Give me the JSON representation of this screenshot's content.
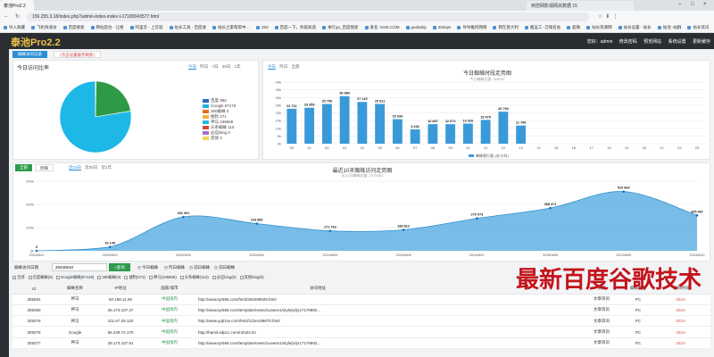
{
  "browser": {
    "tab_title": "泰池Pro2.2",
    "tab_right_title": "到您网影视网关数据 15",
    "url": "156.255.3.18/index.php?admin-index-index-t-17180043577.html",
    "bookmarks": [
      "导入收藏",
      "飞机快速访",
      "百度搜索",
      "网站后台 - 让搜",
      "阿里云 - 上云就",
      "站长工具 - 百度收",
      "站长之家帮帮中…",
      "263",
      "百度一下，你就知道",
      "本叮go_百度搜索",
      "爱名 -DNS.COM",
      "godaddy",
      "263vps",
      "导导推的网络",
      "我在意大利",
      "搬运工 -泛域名站",
      "超微",
      "站长资源网",
      "站长设置 - 站长",
      "站池 -站群",
      "站长资讯",
      "所有书签"
    ]
  },
  "nav": {
    "logo": "泰池Pro2.2",
    "greeting": "您好：admin",
    "links": [
      "修改密码",
      "预览网站",
      "系统设置",
      "更新缓存"
    ]
  },
  "content_tabs": {
    "active": "蜘蛛访问记录",
    "second": "(点击设置缓存刷新)"
  },
  "pie_panel": {
    "title": "今日访问比率",
    "range_tabs": [
      "今日",
      "昨日",
      "7日",
      "30日",
      "1年"
    ],
    "selected": "今日",
    "legend": [
      {
        "label": "百度 986",
        "color": "#2b6bb5"
      },
      {
        "label": "Google 67178",
        "color": "#21b0de"
      },
      {
        "label": "360蜘蛛 0",
        "color": "#e96b2a"
      },
      {
        "label": "搜狗 271",
        "color": "#f0b23a"
      },
      {
        "label": "神马 236506",
        "color": "#1eb8e6"
      },
      {
        "label": "头条蜘蛛 110",
        "color": "#ce4b3a"
      },
      {
        "label": "必应Bing 0",
        "color": "#a46bd2"
      },
      {
        "label": "其他 0",
        "color": "#f5d25a"
      }
    ]
  },
  "hourly_panel": {
    "range_tabs": [
      "今日",
      "昨日",
      "全部"
    ],
    "selected": "今日",
    "title": "今日蜘蛛时段走势图",
    "subtitle": "今日蜘蛛总量: 305087",
    "legend": "蜘蛛爬行量 (次/小时)"
  },
  "trend_panel": {
    "buttons": [
      "全部",
      "明细"
    ],
    "range_tabs": [
      "近10日",
      "近30日",
      "近1年"
    ],
    "selected": "近10日",
    "title": "最近10天蜘蛛访问走势图",
    "subtitle": "近10日蜘蛛总量: 2375551"
  },
  "search": {
    "label": "蜘蛛访问日期",
    "value": "20240610",
    "button": "查询",
    "links": [
      "今日蜘蛛",
      "昨日蜘蛛",
      "前日蜘蛛",
      "前日蜘蛛"
    ]
  },
  "filters": [
    "全部",
    "百度蜘蛛(6)",
    "Google蜘蛛(87148)",
    "360蜘蛛(0)",
    "搜狗(271)",
    "神马(236506)",
    "头条蜘蛛(110)",
    "必应bing(0)",
    "其他bing(0)"
  ],
  "table": {
    "columns": [
      "Id",
      "蜘蛛名称",
      "IP地址",
      "国家/城市",
      "访问地址",
      "",
      "来源",
      "蜘蛛类型",
      "访问时间"
    ],
    "rows": [
      [
        "305081",
        "神马",
        "60.188.11.90",
        "中国境内",
        "http://www.tyr568.com/html/30d499929.html",
        "",
        "文章资讯",
        "PC",
        "2024-"
      ],
      [
        "305080",
        "神马",
        "39.173.107.37",
        "中国境内",
        "http://www.tyr568.com/template/news/zuowen1/style/js/js17179992...",
        "",
        "文章资讯",
        "PC",
        "2024-"
      ],
      [
        "305079",
        "神马",
        "101.67.29.120",
        "中国境内",
        "http://www.yqbzss.com/html/122e199870.html",
        "",
        "文章资讯",
        "PC",
        "2024-"
      ],
      [
        "305078",
        "Google",
        "66.249.72.170",
        "中国境内",
        "http://hamil.edpcc.com/robots.txt",
        "",
        "文章资讯",
        "PC",
        "2024-"
      ],
      [
        "305077",
        "神马",
        "39.173.107.91",
        "中国境内",
        "http://www.tyr568.com/template/news/zuowen1/style/js/js17179992...",
        "",
        "文章资讯",
        "PC",
        "2024-"
      ]
    ]
  },
  "watermark": "最新百度谷歌技术",
  "chart_data": [
    {
      "type": "pie",
      "labels": [
        "百度",
        "Google",
        "360蜘蛛",
        "搜狗",
        "神马",
        "头条蜘蛛",
        "必应Bing",
        "其他"
      ],
      "values": [
        986,
        67178,
        0,
        271,
        236506,
        110,
        0,
        0
      ],
      "colors": [
        "#2b6bb5",
        "#2e9a46",
        "#e96b2a",
        "#f0b23a",
        "#1eb8e6",
        "#ce4b3a",
        "#a46bd2",
        "#f5d25a"
      ]
    },
    {
      "type": "bar",
      "title": "今日蜘蛛时段走势图",
      "categories": [
        "00",
        "01",
        "02",
        "03",
        "04",
        "05",
        "06",
        "07",
        "08",
        "09",
        "10",
        "11",
        "12",
        "13",
        "14",
        "15",
        "16",
        "17",
        "18",
        "19",
        "20",
        "21",
        "22",
        "23"
      ],
      "values": [
        22711,
        23353,
        25790,
        30884,
        27119,
        25811,
        15934,
        9292,
        12687,
        12672,
        13026,
        15470,
        20794,
        11796,
        0,
        0,
        0,
        0,
        0,
        0,
        0,
        0,
        0,
        0
      ],
      "labels": [
        "22 711",
        "23 353",
        "25 790",
        "30 884",
        "27 119",
        "25 811",
        "15 934",
        "9 292",
        "12 687",
        "12 672",
        "13 026",
        "15 470",
        "20 794",
        "11 796",
        "",
        "",
        "",
        "",
        "",
        "",
        "",
        "",
        "",
        ""
      ],
      "yticks": [
        "0k",
        "5k",
        "10k",
        "15k",
        "20k",
        "25k",
        "30k",
        "35k",
        "40k"
      ],
      "ylim": [
        0,
        40000
      ],
      "color": "#3a9ad9"
    },
    {
      "type": "area",
      "title": "最近10天蜘蛛访问走势图",
      "x": [
        "20240601",
        "20240602",
        "20240603",
        "20240604",
        "20240605",
        "20240606",
        "20240607",
        "20240608",
        "20240609",
        "20240610"
      ],
      "values": [
        0,
        33145,
        292001,
        233880,
        171763,
        180812,
        279073,
        368471,
        510664,
        305087
      ],
      "labels": [
        "0",
        "33 145",
        "292 001",
        "233 880",
        "171 763",
        "180 812",
        "279 073",
        "368 471",
        "510 664",
        "305 087"
      ],
      "yticks": [
        "0k",
        "200k",
        "400k",
        "600k"
      ],
      "ylim": [
        0,
        600000
      ],
      "color": "#5fb2e3"
    }
  ]
}
